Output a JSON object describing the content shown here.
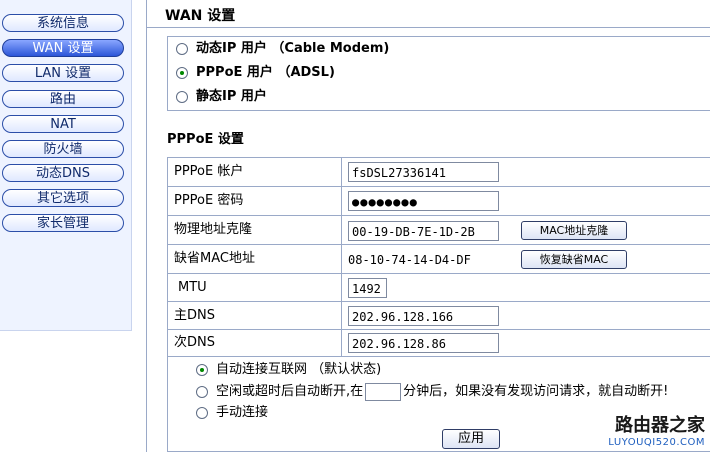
{
  "sidebar": {
    "items": [
      {
        "label": "系统信息",
        "active": false
      },
      {
        "label": "WAN 设置",
        "active": true
      },
      {
        "label": "LAN 设置",
        "active": false
      },
      {
        "label": "路由",
        "active": false
      },
      {
        "label": "NAT",
        "active": false
      },
      {
        "label": "防火墙",
        "active": false
      },
      {
        "label": "动态DNS",
        "active": false
      },
      {
        "label": "其它选项",
        "active": false
      },
      {
        "label": "家长管理",
        "active": false
      }
    ]
  },
  "main": {
    "title": "WAN 设置",
    "connection_types": [
      {
        "label": "动态IP 用户 （Cable Modem)",
        "selected": false
      },
      {
        "label": "PPPoE 用户 （ADSL)",
        "selected": true
      },
      {
        "label": "静态IP 用户",
        "selected": false
      }
    ],
    "pppoe_heading": "PPPoE 设置",
    "fields": {
      "account_label": "PPPoE 帐户",
      "account_value": "fsDSL27336141",
      "password_label": "PPPoE 密码",
      "password_value": "●●●●●●●●",
      "mac_clone_label": "物理地址克隆",
      "mac_clone_value": "00-19-DB-7E-1D-2B",
      "mac_clone_button": "MAC地址克隆",
      "default_mac_label": "缺省MAC地址",
      "default_mac_value": "08-10-74-14-D4-DF",
      "restore_mac_button": "恢复缺省MAC",
      "mtu_label": "MTU",
      "mtu_value": "1492",
      "primary_dns_label": "主DNS",
      "primary_dns_value": "202.96.128.166",
      "secondary_dns_label": "次DNS",
      "secondary_dns_value": "202.96.128.86"
    },
    "options": {
      "auto_connect": "自动连接互联网 （默认状态)",
      "idle_prefix": "空闲或超时后自动断开,在",
      "idle_suffix": "分钟后，如果没有发现访问请求，就自动断开!",
      "manual_connect": "手动连接",
      "selected": "auto_connect"
    },
    "apply_button": "应用"
  },
  "watermark": {
    "text": "路由器之家",
    "url": "LUYOUQI520.COM"
  }
}
